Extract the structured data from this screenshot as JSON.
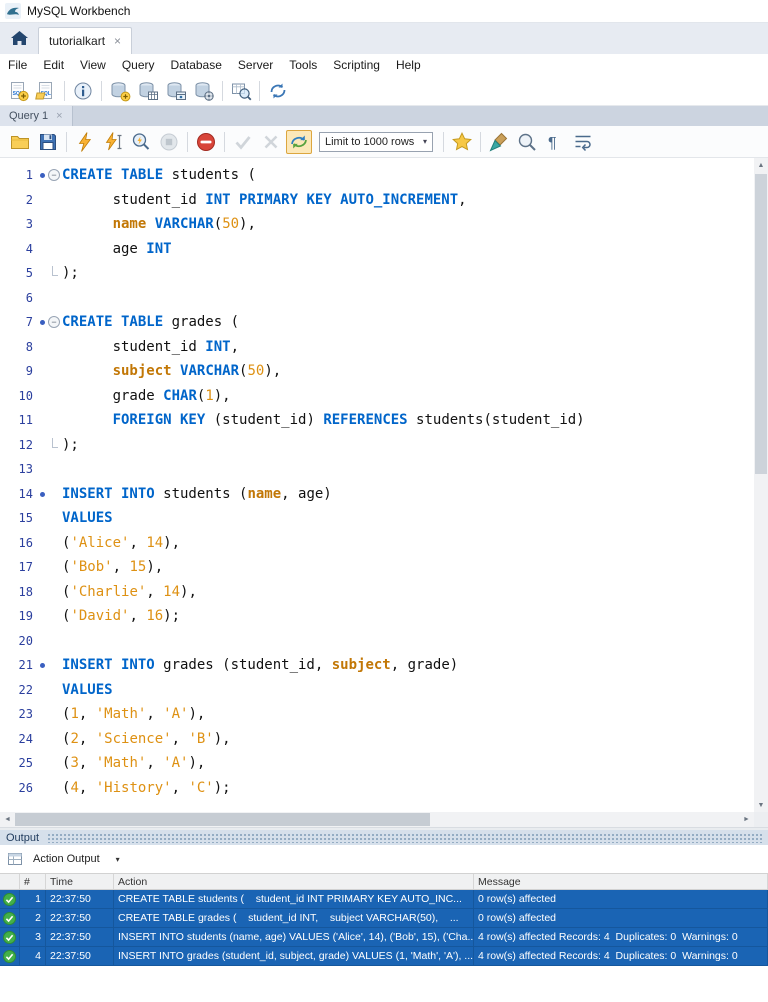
{
  "window": {
    "title": "MySQL Workbench"
  },
  "doc_tabs": {
    "tabs": [
      {
        "label": "tutorialkart",
        "close_label": "×"
      }
    ]
  },
  "menu_bar": {
    "items": [
      "File",
      "Edit",
      "View",
      "Query",
      "Database",
      "Server",
      "Tools",
      "Scripting",
      "Help"
    ]
  },
  "main_toolbar": {
    "items": [
      "new-query-tab-icon",
      "open-sql-script-icon",
      "|",
      "inspector-icon",
      "|",
      "create-schema-icon",
      "create-table-icon",
      "create-view-icon",
      "create-routine-icon",
      "|",
      "search-table-data-icon",
      "|",
      "reconnect-dbms-icon"
    ]
  },
  "query_tab_bar": {
    "tabs": [
      {
        "label": "Query 1",
        "close_label": "×"
      }
    ]
  },
  "query_toolbar": {
    "items": [
      "open-script-icon",
      "save-script-icon",
      "|",
      "execute-icon",
      "execute-current-icon",
      "explain-icon",
      "stop-icon",
      "|",
      "toggle-stop-on-error-icon",
      "|",
      "commit-icon",
      "rollback-icon",
      "toggle-autocommit-icon",
      "LIMIT_DROPDOWN",
      "|",
      "save-snippet-icon",
      "|",
      "beautify-icon",
      "find-icon",
      "invisible-chars-icon",
      "wrap-text-icon"
    ],
    "toggled": "toggle-autocommit-icon",
    "disabled": [
      "stop-icon",
      "commit-icon",
      "rollback-icon"
    ],
    "limit_value": "Limit to 1000 rows"
  },
  "editor": {
    "lines": [
      {
        "n": 1,
        "m": "stmt-fold",
        "t": [
          [
            "k",
            "CREATE TABLE"
          ],
          [
            "p",
            " students ("
          ]
        ]
      },
      {
        "n": 2,
        "m": "",
        "t": [
          [
            "p",
            "      student_id "
          ],
          [
            "k",
            "INT PRIMARY KEY AUTO_INCREMENT"
          ],
          [
            "p",
            ","
          ]
        ]
      },
      {
        "n": 3,
        "m": "",
        "t": [
          [
            "p",
            "      "
          ],
          [
            "o",
            "name"
          ],
          [
            "p",
            " "
          ],
          [
            "k",
            "VARCHAR"
          ],
          [
            "p",
            "("
          ],
          [
            "n",
            "50"
          ],
          [
            "p",
            "),"
          ]
        ]
      },
      {
        "n": 4,
        "m": "",
        "t": [
          [
            "p",
            "      age "
          ],
          [
            "k",
            "INT"
          ]
        ]
      },
      {
        "n": 5,
        "m": "fold-end",
        "t": [
          [
            "p",
            ");"
          ]
        ]
      },
      {
        "n": 6,
        "m": "",
        "t": []
      },
      {
        "n": 7,
        "m": "stmt-fold",
        "t": [
          [
            "k",
            "CREATE TABLE"
          ],
          [
            "p",
            " grades ("
          ]
        ]
      },
      {
        "n": 8,
        "m": "",
        "t": [
          [
            "p",
            "      student_id "
          ],
          [
            "k",
            "INT"
          ],
          [
            "p",
            ","
          ]
        ]
      },
      {
        "n": 9,
        "m": "",
        "t": [
          [
            "p",
            "      "
          ],
          [
            "o",
            "subject"
          ],
          [
            "p",
            " "
          ],
          [
            "k",
            "VARCHAR"
          ],
          [
            "p",
            "("
          ],
          [
            "n",
            "50"
          ],
          [
            "p",
            "),"
          ]
        ]
      },
      {
        "n": 10,
        "m": "",
        "t": [
          [
            "p",
            "      grade "
          ],
          [
            "k",
            "CHAR"
          ],
          [
            "p",
            "("
          ],
          [
            "n",
            "1"
          ],
          [
            "p",
            "),"
          ]
        ]
      },
      {
        "n": 11,
        "m": "",
        "t": [
          [
            "p",
            "      "
          ],
          [
            "k",
            "FOREIGN KEY"
          ],
          [
            "p",
            " (student_id) "
          ],
          [
            "k",
            "REFERENCES"
          ],
          [
            "p",
            " students(student_id)"
          ]
        ]
      },
      {
        "n": 12,
        "m": "fold-end",
        "t": [
          [
            "p",
            ");"
          ]
        ]
      },
      {
        "n": 13,
        "m": "",
        "t": []
      },
      {
        "n": 14,
        "m": "stmt",
        "t": [
          [
            "k",
            "INSERT INTO"
          ],
          [
            "p",
            " students ("
          ],
          [
            "o",
            "name"
          ],
          [
            "p",
            ", age)"
          ]
        ]
      },
      {
        "n": 15,
        "m": "",
        "t": [
          [
            "k",
            "VALUES"
          ]
        ]
      },
      {
        "n": 16,
        "m": "",
        "t": [
          [
            "p",
            "("
          ],
          [
            "s",
            "'Alice'"
          ],
          [
            "p",
            ", "
          ],
          [
            "n",
            "14"
          ],
          [
            "p",
            "),"
          ]
        ]
      },
      {
        "n": 17,
        "m": "",
        "t": [
          [
            "p",
            "("
          ],
          [
            "s",
            "'Bob'"
          ],
          [
            "p",
            ", "
          ],
          [
            "n",
            "15"
          ],
          [
            "p",
            "),"
          ]
        ]
      },
      {
        "n": 18,
        "m": "",
        "t": [
          [
            "p",
            "("
          ],
          [
            "s",
            "'Charlie'"
          ],
          [
            "p",
            ", "
          ],
          [
            "n",
            "14"
          ],
          [
            "p",
            "),"
          ]
        ]
      },
      {
        "n": 19,
        "m": "",
        "t": [
          [
            "p",
            "("
          ],
          [
            "s",
            "'David'"
          ],
          [
            "p",
            ", "
          ],
          [
            "n",
            "16"
          ],
          [
            "p",
            ");"
          ]
        ]
      },
      {
        "n": 20,
        "m": "",
        "t": []
      },
      {
        "n": 21,
        "m": "stmt",
        "t": [
          [
            "k",
            "INSERT INTO"
          ],
          [
            "p",
            " grades (student_id, "
          ],
          [
            "o",
            "subject"
          ],
          [
            "p",
            ", grade)"
          ]
        ]
      },
      {
        "n": 22,
        "m": "",
        "t": [
          [
            "k",
            "VALUES"
          ]
        ]
      },
      {
        "n": 23,
        "m": "",
        "t": [
          [
            "p",
            "("
          ],
          [
            "n",
            "1"
          ],
          [
            "p",
            ", "
          ],
          [
            "s",
            "'Math'"
          ],
          [
            "p",
            ", "
          ],
          [
            "s",
            "'A'"
          ],
          [
            "p",
            "),"
          ]
        ]
      },
      {
        "n": 24,
        "m": "",
        "t": [
          [
            "p",
            "("
          ],
          [
            "n",
            "2"
          ],
          [
            "p",
            ", "
          ],
          [
            "s",
            "'Science'"
          ],
          [
            "p",
            ", "
          ],
          [
            "s",
            "'B'"
          ],
          [
            "p",
            "),"
          ]
        ]
      },
      {
        "n": 25,
        "m": "",
        "t": [
          [
            "p",
            "("
          ],
          [
            "n",
            "3"
          ],
          [
            "p",
            ", "
          ],
          [
            "s",
            "'Math'"
          ],
          [
            "p",
            ", "
          ],
          [
            "s",
            "'A'"
          ],
          [
            "p",
            "),"
          ]
        ]
      },
      {
        "n": 26,
        "m": "",
        "t": [
          [
            "p",
            "("
          ],
          [
            "n",
            "4"
          ],
          [
            "p",
            ", "
          ],
          [
            "s",
            "'History'"
          ],
          [
            "p",
            ", "
          ],
          [
            "s",
            "'C'"
          ],
          [
            "p",
            ");"
          ]
        ]
      }
    ]
  },
  "output_panel": {
    "title": "Output",
    "selector_value": "Action Output",
    "grid": {
      "columns": [
        "#",
        "Time",
        "Action",
        "Message"
      ],
      "rows": [
        {
          "status": "success",
          "num": "1",
          "time": "22:37:50",
          "action": "CREATE TABLE students (    student_id INT PRIMARY KEY AUTO_INC...",
          "message": "0 row(s) affected"
        },
        {
          "status": "success",
          "num": "2",
          "time": "22:37:50",
          "action": "CREATE TABLE grades (    student_id INT,    subject VARCHAR(50),    ...",
          "message": "0 row(s) affected"
        },
        {
          "status": "success",
          "num": "3",
          "time": "22:37:50",
          "action": "INSERT INTO students (name, age) VALUES ('Alice', 14), ('Bob', 15), ('Cha...",
          "message": "4 row(s) affected Records: 4  Duplicates: 0  Warnings: 0"
        },
        {
          "status": "success",
          "num": "4",
          "time": "22:37:50",
          "action": "INSERT INTO grades (student_id, subject, grade) VALUES (1, 'Math', 'A'), ...",
          "message": "4 row(s) affected Records: 4  Duplicates: 0  Warnings: 0"
        }
      ]
    }
  },
  "colors": {
    "keyword": "#0065ca",
    "literal": "#de9113",
    "selected_row": "#1a64b4",
    "success": "#43b049"
  }
}
